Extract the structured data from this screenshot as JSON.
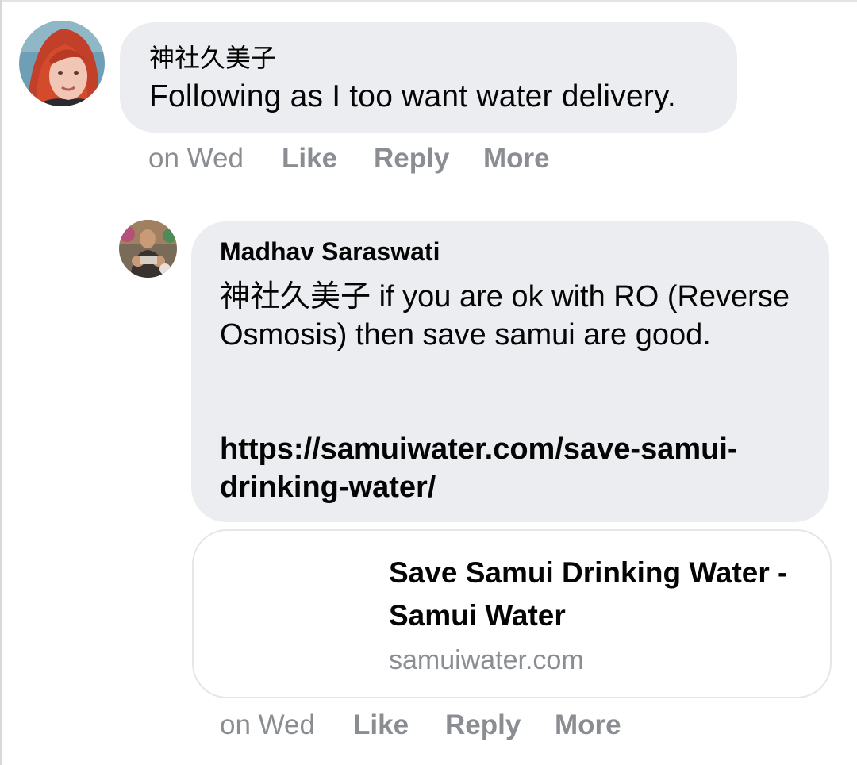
{
  "comments": [
    {
      "author": "神社久美子",
      "text": "Following as I too want water delivery.",
      "time": "on Wed",
      "actions": {
        "like": "Like",
        "reply": "Reply",
        "more": "More"
      }
    },
    {
      "author": "Madhav Saraswati",
      "mention": "神社久美子",
      "text": " if you are ok with RO (Reverse Osmosis) then save samui are good.",
      "link": "https://samuiwater.com/save-samui-drinking-water/",
      "preview": {
        "title": "Save Samui Drinking Water - Samui Water",
        "domain": "samuiwater.com"
      },
      "time": "on Wed",
      "actions": {
        "like": "Like",
        "reply": "Reply",
        "more": "More"
      }
    }
  ],
  "colors": {
    "bubble": "#ebedf0",
    "meta_text": "#8a8d91",
    "primary_text": "#050505",
    "card_border": "#e4e6eb"
  },
  "icons": [
    "avatar-photo-red-hair",
    "avatar-photo-group"
  ]
}
